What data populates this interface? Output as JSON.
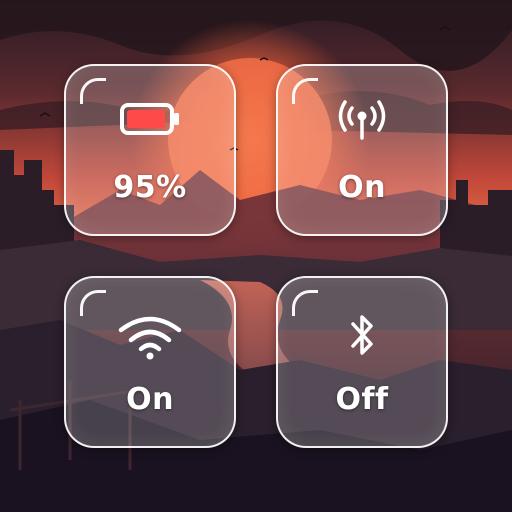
{
  "tiles": {
    "battery": {
      "icon": "battery-icon",
      "value": "95%",
      "level": 0.95
    },
    "signal": {
      "icon": "antenna-signal-icon",
      "value": "On"
    },
    "wifi": {
      "icon": "wifi-icon",
      "value": "On"
    },
    "bluetooth": {
      "icon": "bluetooth-icon",
      "value": "Off"
    }
  },
  "colors": {
    "tile_glass": "rgba(255,255,255,0.20)",
    "tile_border": "#ffffff",
    "text": "#ffffff",
    "sky_top": "#2a1a24",
    "sun": "#f0603a"
  }
}
